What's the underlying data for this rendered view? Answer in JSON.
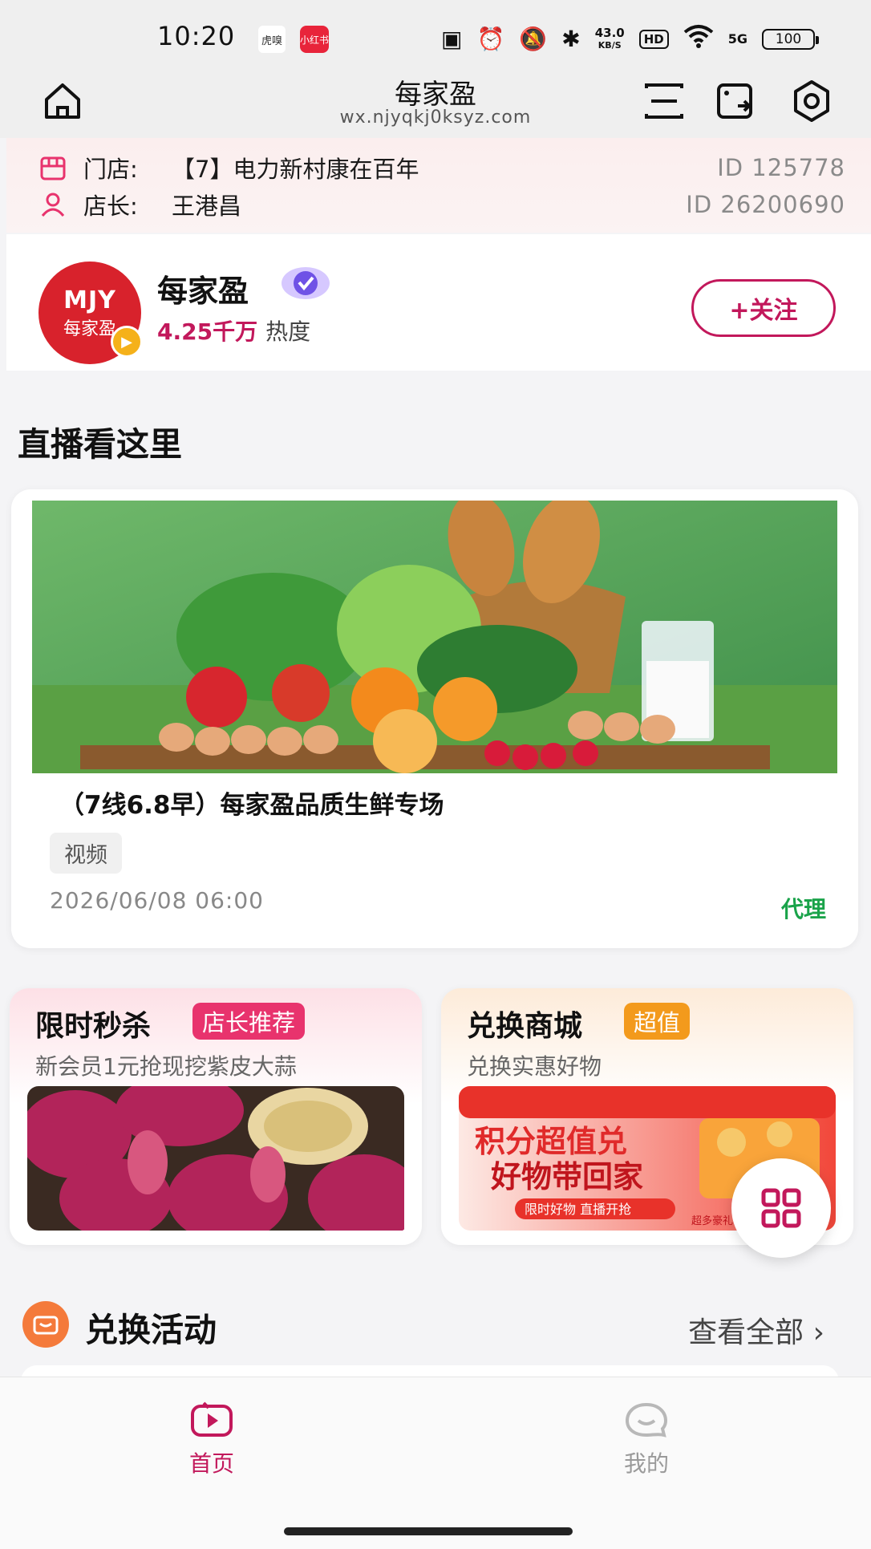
{
  "status_bar": {
    "time": "10:20",
    "app1": "虎嗅",
    "app2": "小红书",
    "speed_value": "43.0",
    "speed_unit": "KB/S",
    "hd": "HD",
    "network": "5G",
    "battery": "100"
  },
  "titlebar": {
    "title": "每家盈",
    "url": "wx.njyqkj0ksyz.com"
  },
  "store": {
    "store_label": "门店:",
    "store_name": "【7】电力新村康在百年",
    "store_id": "ID 125778",
    "manager_label": "店长:",
    "manager_name": "王港昌",
    "manager_id": "ID 26200690"
  },
  "profile": {
    "logo_text": "MJY",
    "logo_cn": "每家盈",
    "name": "每家盈",
    "heat_value": "4.25千万",
    "heat_label": "热度",
    "follow_label": "+关注"
  },
  "live_section": {
    "title": "直播看这里",
    "card": {
      "title": "（7线6.8早）每家盈品质生鲜专场",
      "tag": "视频",
      "datetime": "2026/06/08 06:00",
      "role": "代理"
    }
  },
  "promos": [
    {
      "title": "限时秒杀",
      "tag": "店长推荐",
      "subtitle": "新会员1元抢现挖紫皮大蒜",
      "tag_color": "#e8336d"
    },
    {
      "title": "兑换商城",
      "tag": "超值",
      "subtitle": "兑换实惠好物",
      "tag_color": "#f39a1c",
      "banner_line1": "积分超值兑",
      "banner_line2": "好物带回家",
      "banner_line3": "限时好物 直播开抢",
      "banner_corner": "超多豪礼"
    }
  ],
  "exchange": {
    "title": "兑换活动",
    "view_all": "查看全部 ›"
  },
  "bottom_nav": [
    {
      "label": "首页",
      "active": true
    },
    {
      "label": "我的",
      "active": false
    }
  ],
  "colors": {
    "brand": "#c2185b",
    "agent_green": "#1aa34a",
    "exchange_orange": "#f47a3b"
  }
}
